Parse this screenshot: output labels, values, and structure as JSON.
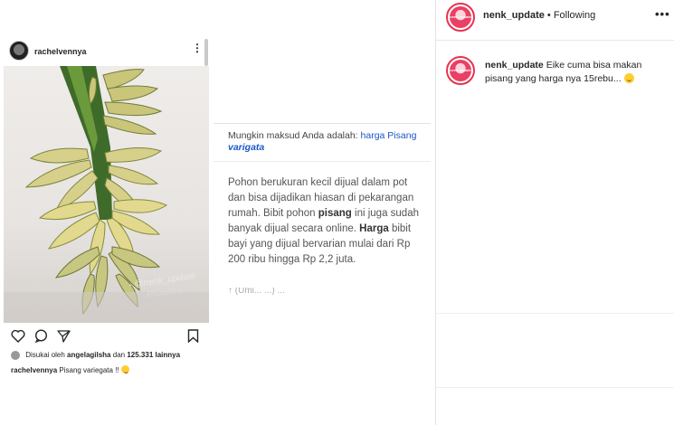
{
  "post": {
    "username": "rachelvennya",
    "likes_prefix": "Disukai oleh",
    "likes_user": "angelagilsha",
    "likes_middle": "dan",
    "likes_count": "125.331 lainnya",
    "caption_user": "rachelvennya",
    "caption_text": "Pisang variegata !!",
    "watermark": "- @nenk_update",
    "watermark2": "PhotoGrid"
  },
  "snippet": {
    "maksud_prefix": "Mungkin maksud Anda adalah:",
    "maksud_link1": "harga Pisang",
    "maksud_link2": "varigata",
    "body_1": "Pohon berukuran kecil dijual dalam pot dan bisa dijadikan hiasan di pekarangan rumah. Bibit pohon",
    "body_bold_1": "pisang",
    "body_2": "ini juga sudah banyak dijual secara online.",
    "body_bold_2": "Harga",
    "body_3": "bibit bayi yang dijual bervarian mulai dari Rp 200 ribu hingga Rp 2,2 juta.",
    "body_cut": "↑ (Umi... ...)  ..."
  },
  "right": {
    "header_user": "nenk_update",
    "header_status": "• Following",
    "avatar_text": "nenk update",
    "comment_user": "nenk_update",
    "comment_text": "Eike cuma bisa makan pisang yang harga nya 15rebu..."
  },
  "colors": {
    "link": "#1a57c7",
    "avatar_ring": "#e8334e"
  }
}
